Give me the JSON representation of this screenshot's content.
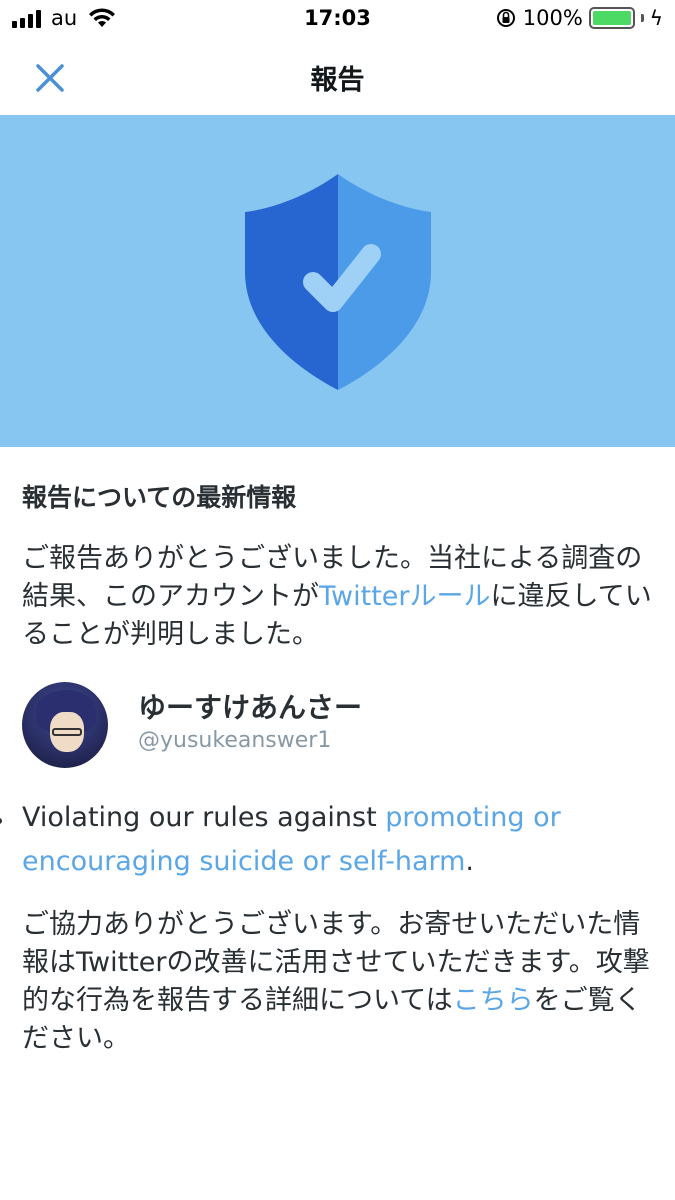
{
  "status_bar": {
    "carrier": "au",
    "time": "17:03",
    "battery": "100%"
  },
  "nav": {
    "title": "報告"
  },
  "section": {
    "heading": "報告についての最新情報",
    "p1_text": "ご報告ありがとうございました。当社による調査の結果、このアカウントが",
    "p1_link": "Twitterルール",
    "p1_tail": "に違反していることが判明しました。"
  },
  "user": {
    "display_name": "ゆーすけあんさー",
    "handle": "@yusukeanswer1"
  },
  "violation": {
    "prefix": "Violating our rules against ",
    "link": "promoting or encouraging suicide or self-harm",
    "suffix": "."
  },
  "thanks": {
    "text": "ご協力ありがとうございます。お寄せいただいた情報はTwitterの改善に活用させていただきます。攻撃的な行為を報告する詳細については",
    "link": "こちら",
    "tail": "をご覧ください。"
  },
  "colors": {
    "hero_bg": "#88c6f2",
    "link": "#5aa6e6",
    "close_icon": "#4a90d9",
    "shield_dark": "#2766d0",
    "shield_light": "#4b9be8"
  }
}
